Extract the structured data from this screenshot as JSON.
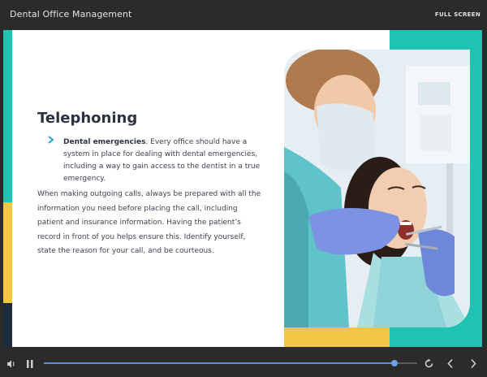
{
  "header": {
    "title": "Dental Office Management",
    "fullscreen_label": "FULL SCREEN"
  },
  "slide": {
    "heading": "Telephoning",
    "bullet": {
      "bold": "Dental emergencies",
      "text": ". Every office should have a system in place for dealing with dental emergencies, including a way to gain access to the dentist in a true emergency."
    },
    "paragraph": "When making outgoing calls, always be prepared with all the information you need before placing the call, including patient and insurance information. Having the patient’s record in front of you helps ensure this. Identify yourself, state the reason for your call, and be courteous."
  },
  "player": {
    "progress": 0.94,
    "icons": {
      "volume": "volume-icon",
      "pause": "pause-icon",
      "replay": "replay-icon",
      "prev": "chevron-left-icon",
      "next": "chevron-right-icon"
    }
  },
  "colors": {
    "teal": "#20c2b1",
    "yellow": "#f3c644",
    "navy": "#1c2c3d",
    "accent_blue": "#5b8fd9"
  }
}
